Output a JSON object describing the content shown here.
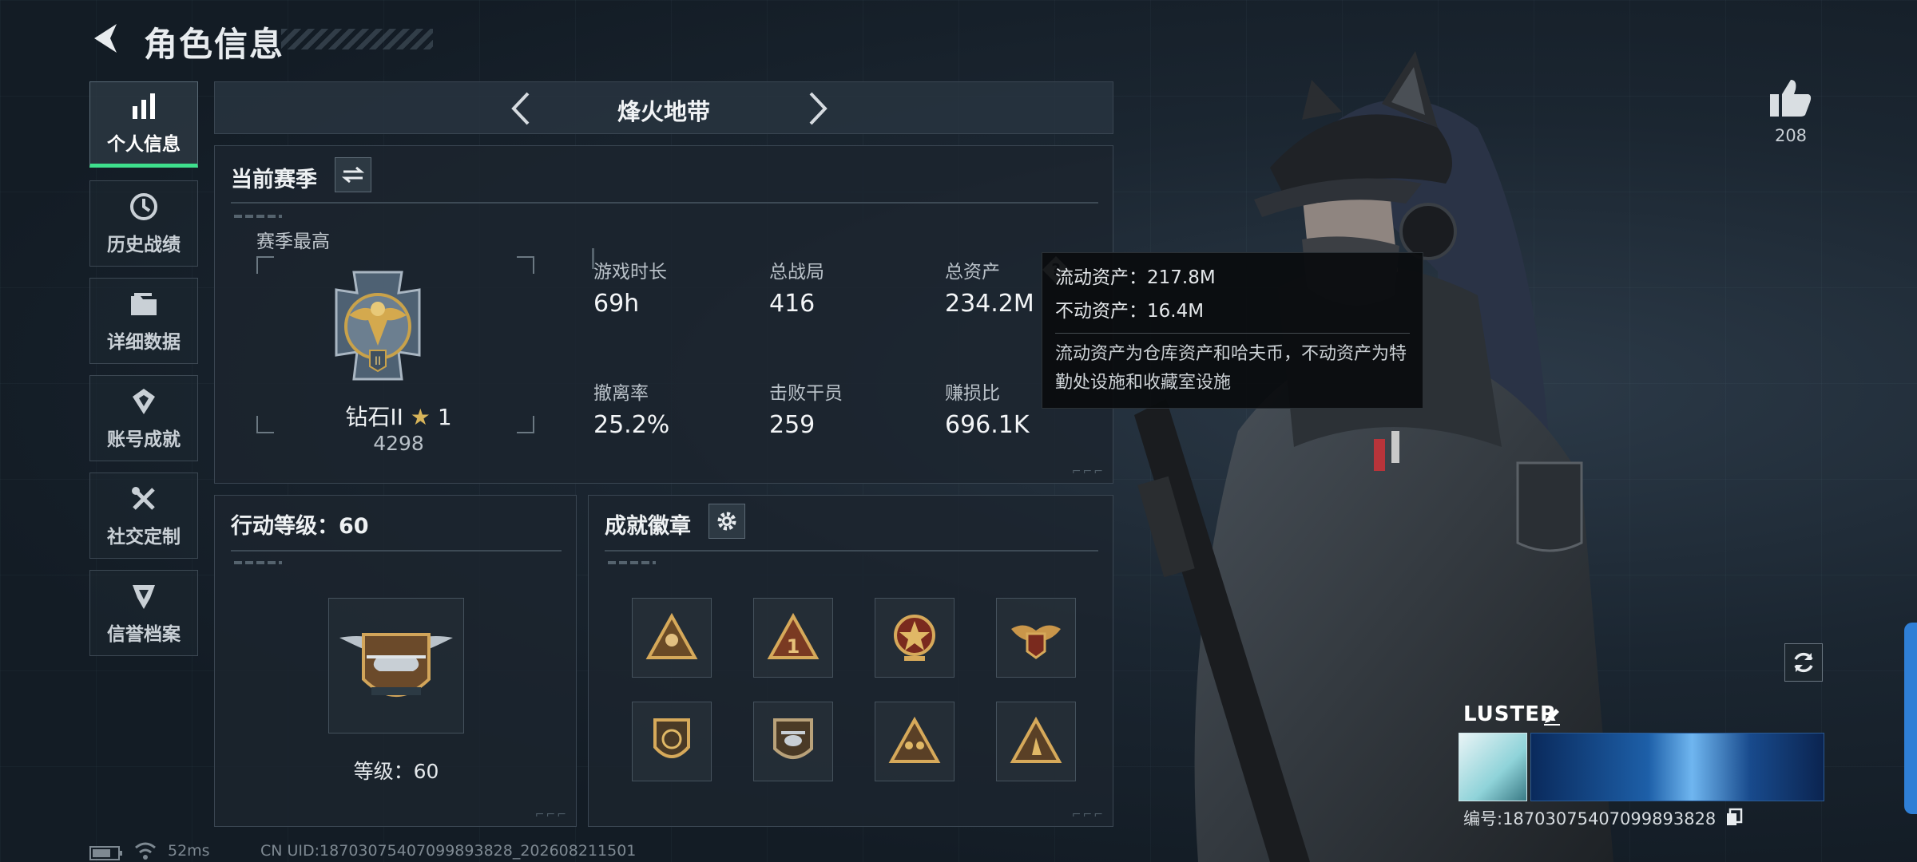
{
  "header": {
    "title": "角色信息",
    "back_icon": "back-arrow-icon"
  },
  "sidebar": {
    "items": [
      {
        "label": "个人信息",
        "icon": "bar-chart-icon",
        "active": true
      },
      {
        "label": "历史战绩",
        "icon": "history-clock-icon",
        "active": false
      },
      {
        "label": "详细数据",
        "icon": "folder-icon",
        "active": false
      },
      {
        "label": "账号成就",
        "icon": "achievement-icon",
        "active": false
      },
      {
        "label": "社交定制",
        "icon": "tools-icon",
        "active": false
      },
      {
        "label": "信誉档案",
        "icon": "shield-badge-icon",
        "active": false
      }
    ]
  },
  "mode_selector": {
    "title": "烽火地带"
  },
  "season": {
    "title": "当前赛季",
    "best_label": "赛季最高",
    "rank_name": "钻石II",
    "rank_stars": "1",
    "rank_score": "4298",
    "stats": [
      {
        "label": "游戏时长",
        "value": "69h"
      },
      {
        "label": "总战局",
        "value": "416"
      },
      {
        "label": "总资产",
        "value": "234.2M"
      },
      {
        "label": "撤离率",
        "value": "25.2%"
      },
      {
        "label": "击败干员",
        "value": "259"
      },
      {
        "label": "赚损比",
        "value": "696.1K"
      }
    ]
  },
  "tooltip": {
    "liquid": "流动资产：217.8M",
    "fixed": "不动资产：16.4M",
    "description": "流动资产为仓库资产和哈夫币，不动资产为特勤处设施和收藏室设施"
  },
  "action_level": {
    "title": "行动等级：60",
    "level_text": "等级：60"
  },
  "badges": {
    "title": "成就徽章"
  },
  "likes": {
    "count": "208"
  },
  "profile": {
    "nickname": "LUSTER",
    "id_text": "编号:18703075407099893828"
  },
  "footer": {
    "ping": "52ms",
    "uid": "CN UID:18703075407099893828_202608211501"
  },
  "colors": {
    "accent_green": "#3ee08d",
    "panel_border": "#3a4652",
    "background": "#1a2530"
  }
}
